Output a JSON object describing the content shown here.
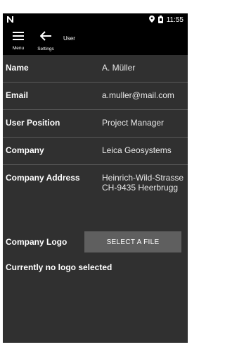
{
  "status_bar": {
    "carrier_icon": "network-n-icon",
    "time": "11:55"
  },
  "app_bar": {
    "menu_label": "Menu",
    "settings_label": "Settings",
    "title": "User"
  },
  "fields": [
    {
      "label": "Name",
      "value": "A. Müller"
    },
    {
      "label": "Email",
      "value": "a.muller@mail.com"
    },
    {
      "label": "User Position",
      "value": "Project Manager"
    },
    {
      "label": "Company",
      "value": "Leica Geosystems"
    },
    {
      "label": "Company Address",
      "value": "Heinrich-Wild-Strasse CH-9435 Heerbrugg"
    }
  ],
  "logo": {
    "label": "Company Logo",
    "button_label": "SELECT A FILE",
    "status": "Currently no logo selected"
  },
  "colors": {
    "background": "#303030",
    "bars": "#000000",
    "button": "#5f5f5f"
  }
}
